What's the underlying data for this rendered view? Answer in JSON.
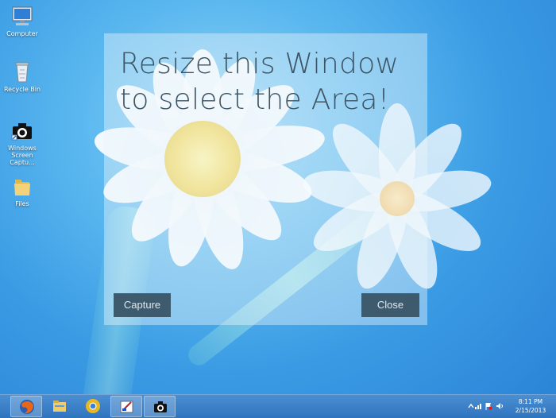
{
  "desktop": {
    "icons": [
      {
        "name": "computer-icon",
        "label": "Computer"
      },
      {
        "name": "recycle-bin-icon",
        "label": "Recycle Bin"
      },
      {
        "name": "camera-icon",
        "label": "Windows Screen Captu..."
      },
      {
        "name": "folder-icon",
        "label": "Files"
      }
    ]
  },
  "capture_window": {
    "heading": "Resize this Window to select the Area!",
    "capture_label": "Capture",
    "close_label": "Close"
  },
  "taskbar": {
    "apps": [
      "firefox-icon",
      "file-explorer-icon",
      "chrome-icon",
      "paint-icon",
      "camera-icon"
    ],
    "active_app": "paint-icon"
  },
  "tray": {
    "icons": [
      "show-hidden-icons-chevron",
      "network-icon",
      "action-center-flag-icon",
      "volume-icon"
    ],
    "time": "8:11 PM",
    "date": "2/15/2013"
  },
  "colors": {
    "desktop_blue": "#3a9be4",
    "button_bg": "#3e5b6e",
    "heading_text": "#3c5464"
  }
}
